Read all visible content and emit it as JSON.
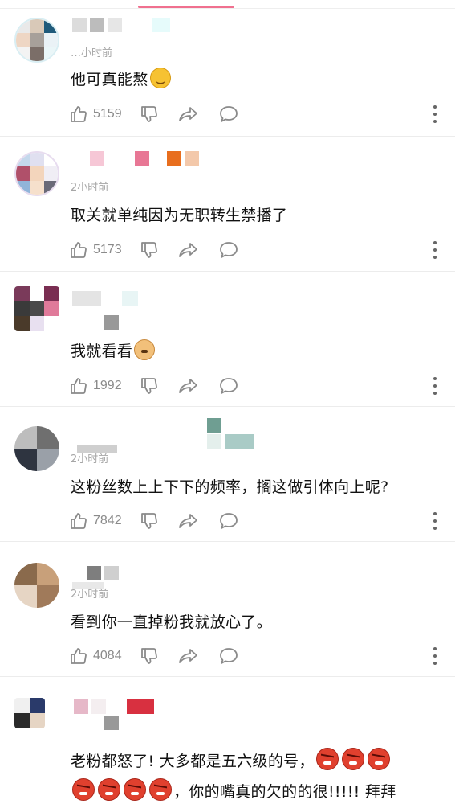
{
  "colors": {
    "accent": "#f0708f",
    "text": "#111111",
    "meta": "#a6a6a6",
    "icon": "#8a8a8a"
  },
  "comments": [
    {
      "time": "…小时前",
      "text": "他可真能熬",
      "emoji": [
        "giggle-emoji"
      ],
      "likes": "5159"
    },
    {
      "time": "2小时前",
      "text": "取关就单纯因为无职转生禁播了",
      "likes": "5173"
    },
    {
      "time": "",
      "text": "我就看看",
      "emoji": [
        "doge-emoji"
      ],
      "likes": "1992"
    },
    {
      "time": "2小时前",
      "text": "这粉丝数上上下下的频率，搁这做引体向上呢?",
      "likes": "7842"
    },
    {
      "time": "2小时前",
      "text": "看到你一直掉粉我就放心了。",
      "likes": "4084"
    },
    {
      "time": "",
      "text_line1": "老粉都怒了! 大多都是五六级的号，",
      "text_line2": "，你的嘴真的欠的的很!!!!! 拜拜",
      "emoji": [
        "angry-emoji"
      ]
    }
  ],
  "icons": [
    "thumbs-up-icon",
    "thumbs-down-icon",
    "share-icon",
    "comment-icon",
    "more-vertical-icon"
  ]
}
